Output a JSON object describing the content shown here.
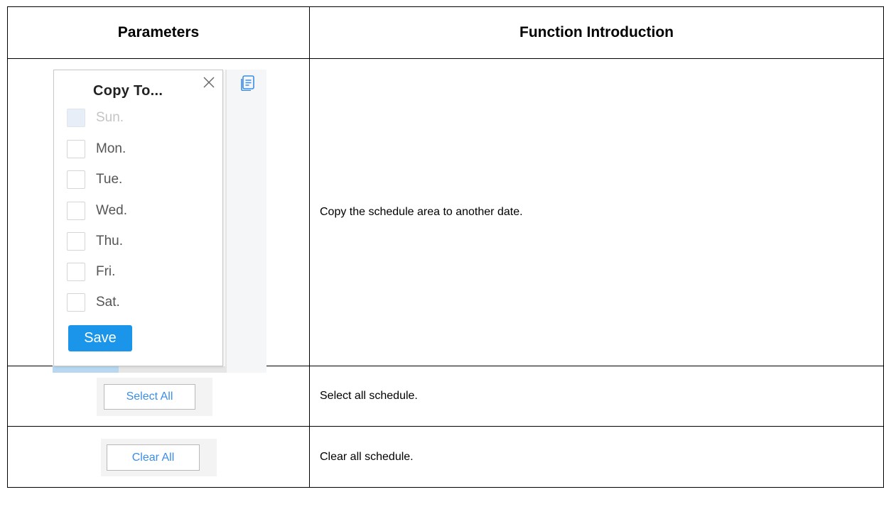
{
  "table": {
    "header": {
      "parameters": "Parameters",
      "function_introduction": "Function Introduction"
    },
    "rows": [
      {
        "description": "Copy the schedule area to another date.",
        "copy_dialog": {
          "title": "Copy To...",
          "days": [
            {
              "label": "Sun.",
              "disabled": true,
              "checked": false
            },
            {
              "label": "Mon.",
              "disabled": false,
              "checked": false
            },
            {
              "label": "Tue.",
              "disabled": false,
              "checked": false
            },
            {
              "label": "Wed.",
              "disabled": false,
              "checked": false
            },
            {
              "label": "Thu.",
              "disabled": false,
              "checked": false
            },
            {
              "label": "Fri.",
              "disabled": false,
              "checked": false
            },
            {
              "label": "Sat.",
              "disabled": false,
              "checked": false
            }
          ],
          "save_label": "Save",
          "close_icon": "close-icon",
          "copy_icon": "copy-document-icon"
        }
      },
      {
        "button_label": "Select All",
        "description": "Select all schedule."
      },
      {
        "button_label": "Clear All",
        "description": "Clear all schedule."
      }
    ]
  },
  "colors": {
    "accent_blue": "#1a95ea",
    "link_blue": "#3a8ee6",
    "border": "#000000"
  }
}
